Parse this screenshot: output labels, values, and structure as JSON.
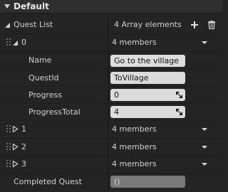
{
  "header": {
    "title": "Default"
  },
  "quest_list": {
    "label": "Quest List",
    "summary": "4 Array elements",
    "add_icon": "plus-icon",
    "delete_icon": "trash-icon"
  },
  "elements": [
    {
      "index": "0",
      "summary": "4 members",
      "expanded": true
    },
    {
      "index": "1",
      "summary": "4 members",
      "expanded": false
    },
    {
      "index": "2",
      "summary": "4 members",
      "expanded": false
    },
    {
      "index": "3",
      "summary": "4 members",
      "expanded": false
    }
  ],
  "fields": {
    "name": {
      "label": "Name",
      "value": "Go to the village"
    },
    "quest_id": {
      "label": "QuestId",
      "value": "ToVillage"
    },
    "progress": {
      "label": "Progress",
      "value": "0"
    },
    "progress_total": {
      "label": "ProgressTotal",
      "value": "4"
    }
  },
  "completed_quest": {
    "label": "Completed Quest",
    "value": "()"
  },
  "colors": {
    "background": "#242424",
    "header": "#2f2f2f",
    "field": "#dcdcdc",
    "disabled_field": "#7a7a7a"
  }
}
